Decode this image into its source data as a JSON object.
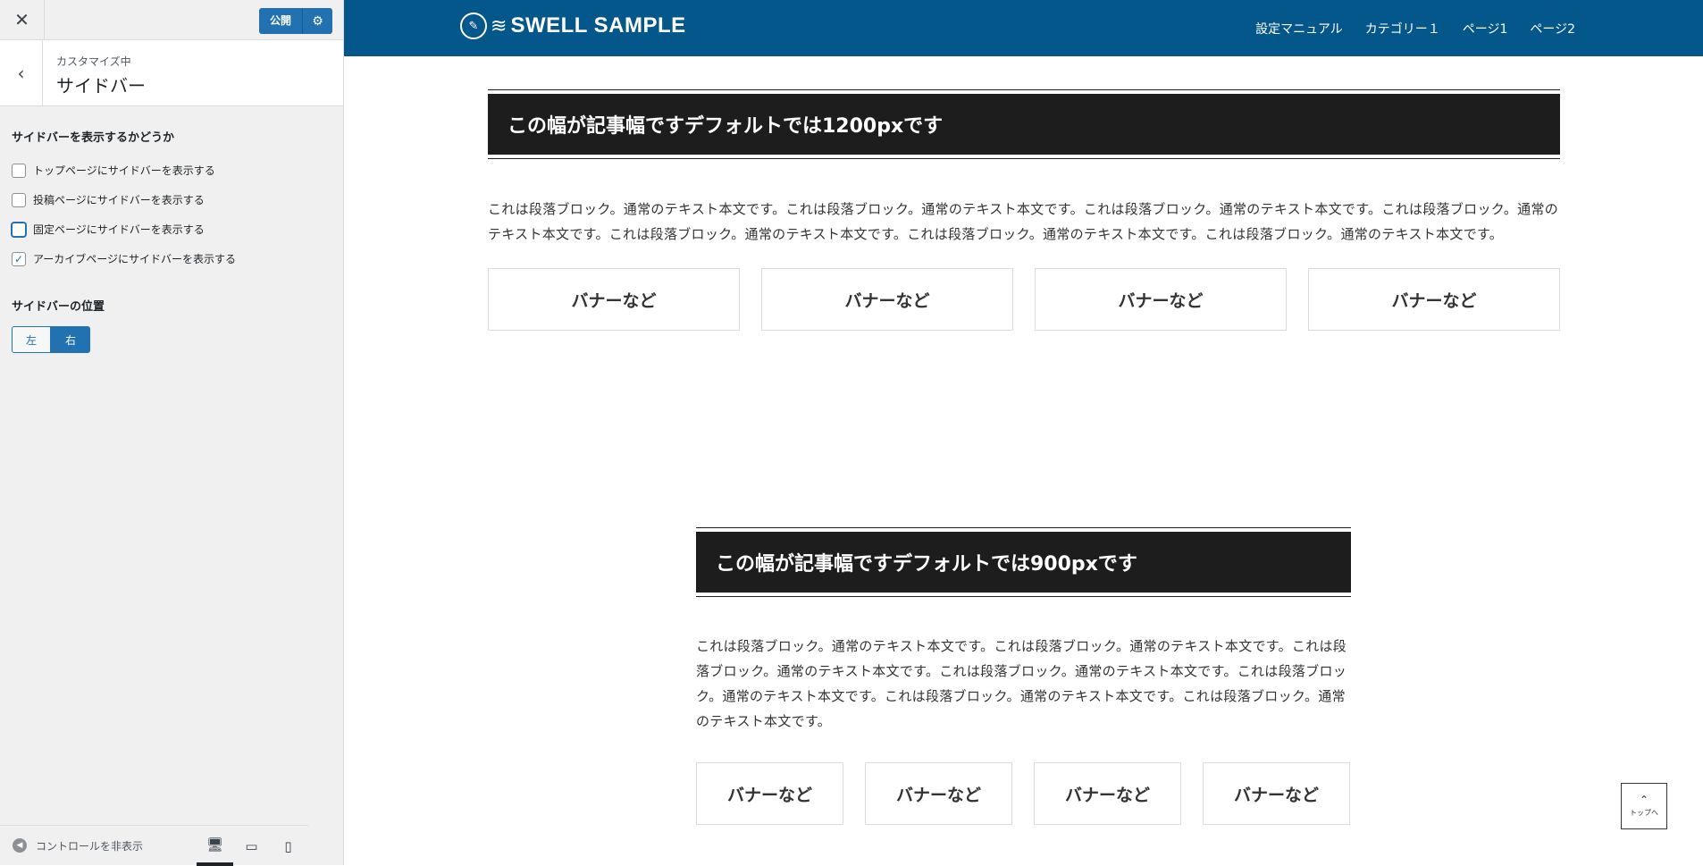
{
  "customizer": {
    "close_icon": "close-icon",
    "publish_label": "公開",
    "publish_gear_icon": "gear-icon",
    "section": {
      "back_icon": "chevron-left-icon",
      "subtitle": "カスタマイズ中",
      "title": "サイドバー"
    },
    "display_heading": "サイドバーを表示するかどうか",
    "checkboxes": [
      {
        "label": "トップページにサイドバーを表示する",
        "checked": false
      },
      {
        "label": "投稿ページにサイドバーを表示する",
        "checked": false
      },
      {
        "label": "固定ページにサイドバーを表示する",
        "checked": false
      },
      {
        "label": "アーカイブページにサイドバーを表示する",
        "checked": true
      }
    ],
    "position_heading": "サイドバーの位置",
    "position_options": [
      {
        "label": "左",
        "selected": false
      },
      {
        "label": "右",
        "selected": true
      }
    ],
    "footer": {
      "hide_label": "コントロールを非表示",
      "devices": [
        "desktop-icon",
        "tablet-icon",
        "mobile-icon"
      ],
      "active_device": "desktop-icon"
    }
  },
  "site": {
    "logo_text": "SWELL SAMPLE",
    "nav": [
      "設定マニュアル",
      "カテゴリー１",
      "ページ1",
      "ページ2"
    ]
  },
  "articles": [
    {
      "heading": "この幅が記事幅ですデフォルトでは1200pxです",
      "paragraph": "これは段落ブロック。通常のテキスト本文です。これは段落ブロック。通常のテキスト本文です。これは段落ブロック。通常のテキスト本文です。これは段落ブロック。通常のテキスト本文です。これは段落ブロック。通常のテキスト本文です。これは段落ブロック。通常のテキスト本文です。これは段落ブロック。通常のテキスト本文です。",
      "banners": [
        "バナーなど",
        "バナーなど",
        "バナーなど",
        "バナーなど"
      ]
    },
    {
      "heading": "この幅が記事幅ですデフォルトでは900pxです",
      "paragraph": "これは段落ブロック。通常のテキスト本文です。これは段落ブロック。通常のテキスト本文です。これは段落ブロック。通常のテキスト本文です。これは段落ブロック。通常のテキスト本文です。これは段落ブロック。通常のテキスト本文です。これは段落ブロック。通常のテキスト本文です。これは段落ブロック。通常のテキスト本文です。",
      "banners": [
        "バナーなど",
        "バナーなど",
        "バナーなど",
        "バナーなど"
      ]
    }
  ],
  "to_top_label": "トップへ",
  "colors": {
    "header_bg": "#04578a",
    "heading_bg": "#1d1d1d",
    "wp_blue": "#2271b1"
  }
}
